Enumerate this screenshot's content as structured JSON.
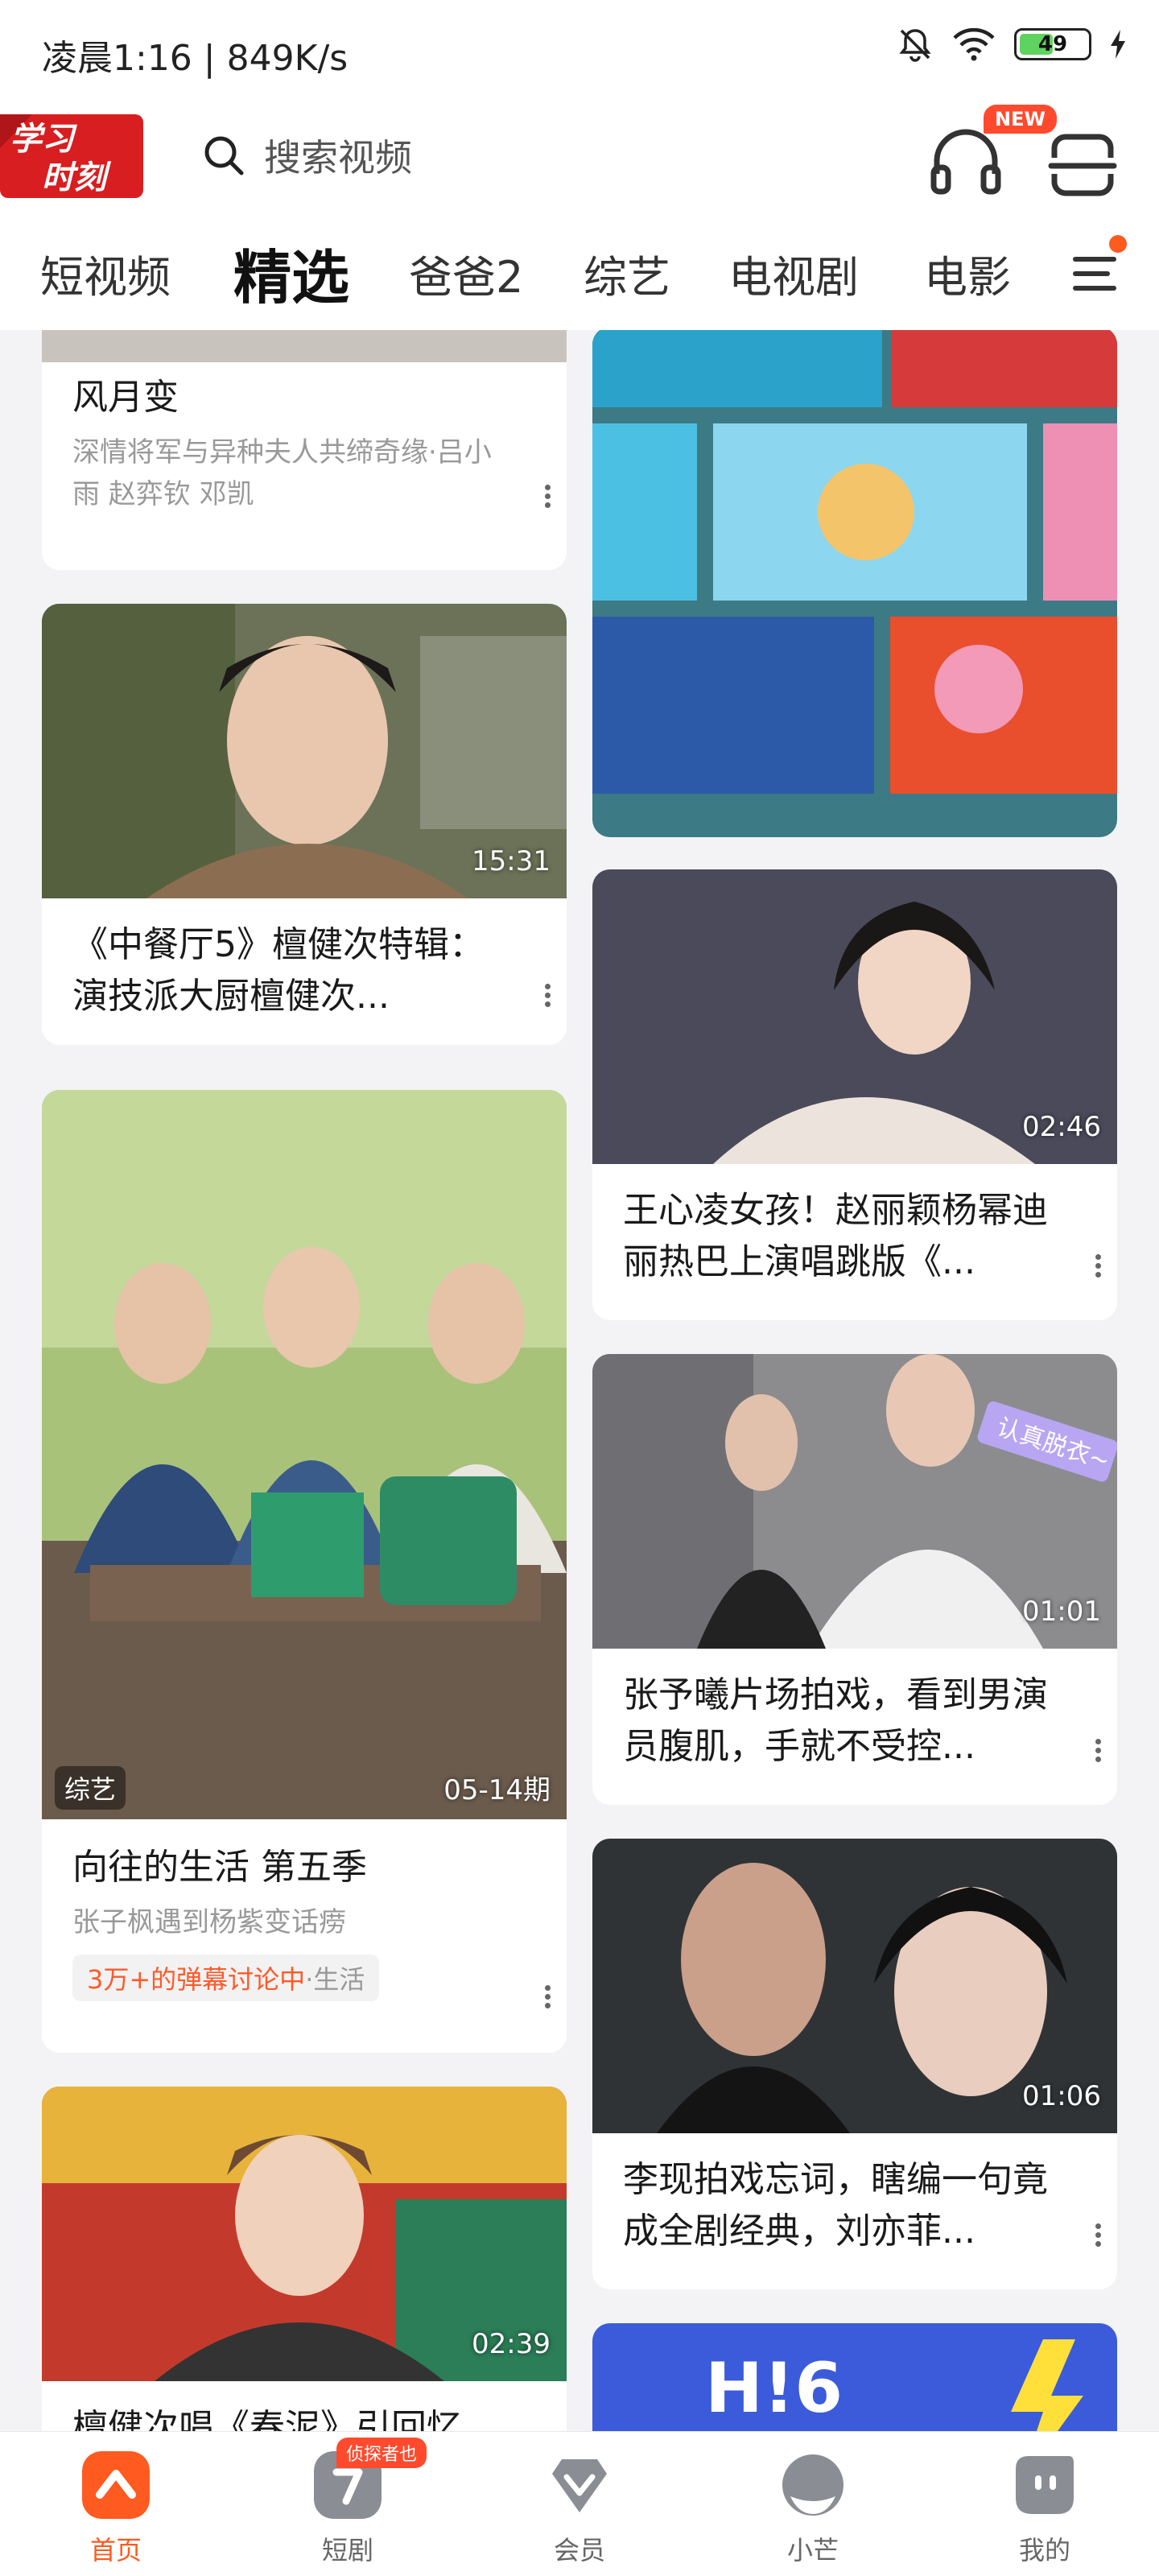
{
  "status_bar": {
    "time": "凌晨1:16 | 849K/s",
    "battery": "49"
  },
  "header": {
    "logo_text": "学习时刻",
    "search_placeholder": "搜索视频",
    "new_badge": "NEW"
  },
  "tabs": [
    {
      "label": "短视频"
    },
    {
      "label": "精选",
      "active": true
    },
    {
      "label": "爸爸2"
    },
    {
      "label": "综艺"
    },
    {
      "label": "电视剧"
    },
    {
      "label": "电影"
    }
  ],
  "left_column": [
    {
      "title": "风月变",
      "subtitle": "深情将军与异种夫人共缔奇缘·吕小雨 赵弈钦 邓凯"
    },
    {
      "title": "《中餐厅5》檀健次特辑：演技派大厨檀健次...",
      "duration": "15:31"
    },
    {
      "title": "向往的生活 第五季",
      "subtitle": "张子枫遇到杨紫变话痨",
      "badge": "综艺",
      "episode": "05-14期",
      "tag_highlight": "3万+的弹幕讨论中",
      "tag_sub": "·生活"
    },
    {
      "title": "檀健次唱《春泥》引回忆",
      "duration": "02:39"
    }
  ],
  "right_column": [
    {
      "title": "王心凌女孩！赵丽颖杨幂迪丽热巴上演唱跳版《...",
      "duration": "02:46"
    },
    {
      "title": "张予曦片场拍戏，看到男演员腹肌，手就不受控...",
      "duration": "01:01",
      "overlay": "认真脱衣~"
    },
    {
      "title": "李现拍戏忘词，瞎编一句竟成全剧经典，刘亦菲...",
      "duration": "01:06"
    },
    {
      "banner_text": "H!6"
    }
  ],
  "bottom_nav": [
    {
      "label": "首页",
      "active": true
    },
    {
      "label": "短剧",
      "badge": "侦探者也"
    },
    {
      "label": "会员"
    },
    {
      "label": "小芒"
    },
    {
      "label": "我的"
    }
  ],
  "colors": {
    "accent": "#ff5a1f",
    "background": "#f3f3f5"
  }
}
